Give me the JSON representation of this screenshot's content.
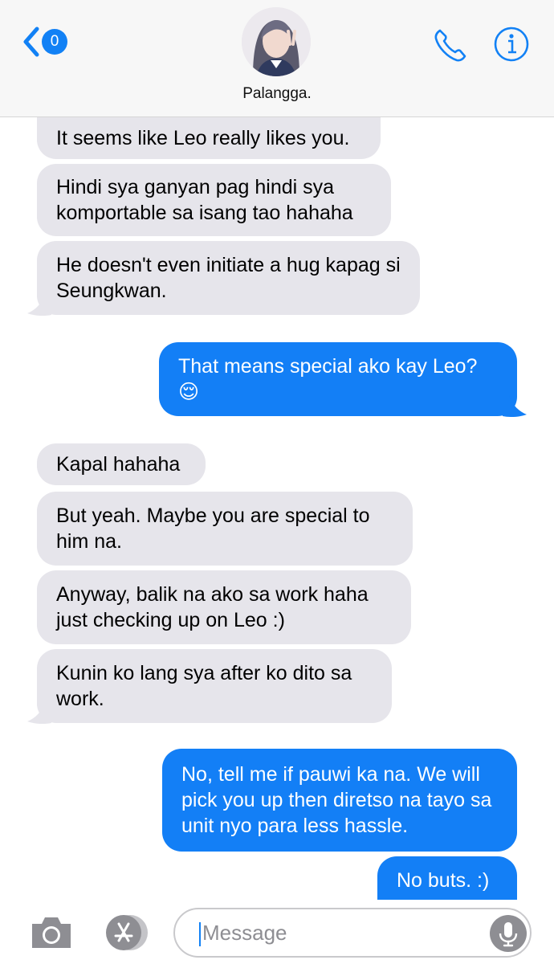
{
  "header": {
    "back_badge_count": "0",
    "contact_name": "Palangga."
  },
  "messages": [
    {
      "side": "in",
      "text": "It seems like Leo really likes you."
    },
    {
      "side": "in",
      "text": "Hindi sya ganyan pag hindi sya komportable sa isang tao hahaha"
    },
    {
      "side": "in",
      "text": "He doesn't even initiate a hug kapag si Seungkwan."
    },
    {
      "side": "out",
      "text": "That means special ako kay Leo? 😌"
    },
    {
      "side": "in",
      "text": "Kapal hahaha"
    },
    {
      "side": "in",
      "text": "But yeah. Maybe you are special to him na."
    },
    {
      "side": "in",
      "text": "Anyway, balik na ako sa work haha just checking up on Leo :)"
    },
    {
      "side": "in",
      "text": "Kunin ko lang sya after ko dito sa work."
    },
    {
      "side": "out",
      "text": "No, tell me if pauwi ka na. We will pick you up then diretso na tayo sa unit nyo para less hassle."
    },
    {
      "side": "out",
      "text": "No buts. :)"
    }
  ],
  "input": {
    "placeholder": "Message"
  },
  "colors": {
    "accent": "#1281f5",
    "incoming_bubble": "#e6e5eb",
    "outgoing_bubble": "#137ff6"
  }
}
